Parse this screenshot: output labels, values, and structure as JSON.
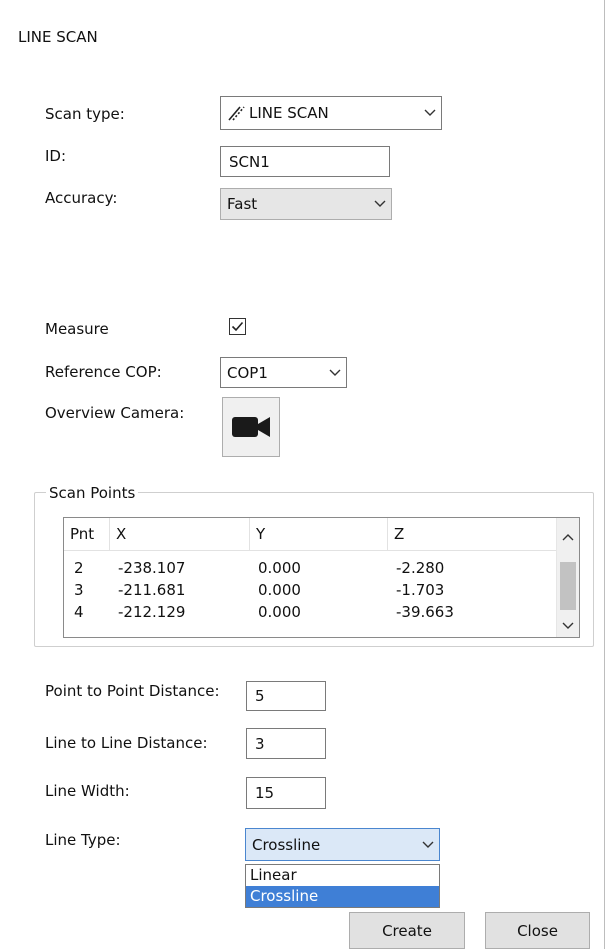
{
  "window": {
    "title": "LINE SCAN"
  },
  "scan_type": {
    "label": "Scan type:",
    "value": "LINE SCAN",
    "icon": "line-scan-icon"
  },
  "id": {
    "label": "ID:",
    "value": "SCN1"
  },
  "accuracy": {
    "label": "Accuracy:",
    "value": "Fast"
  },
  "measure": {
    "label": "Measure",
    "checked": true
  },
  "reference_cop": {
    "label": "Reference COP:",
    "value": "COP1"
  },
  "overview_camera": {
    "label": "Overview Camera:",
    "icon": "video-camera-icon"
  },
  "scan_points": {
    "title": "Scan Points",
    "columns": [
      "Pnt",
      "X",
      "Y",
      "Z"
    ],
    "rows": [
      [
        "2",
        "-238.107",
        "0.000",
        "-2.280"
      ],
      [
        "3",
        "-211.681",
        "0.000",
        "-1.703"
      ],
      [
        "4",
        "-212.129",
        "0.000",
        "-39.663"
      ]
    ]
  },
  "point_to_point": {
    "label": "Point to Point Distance:",
    "value": "5"
  },
  "line_to_line": {
    "label": "Line to Line Distance:",
    "value": "3"
  },
  "line_width": {
    "label": "Line Width:",
    "value": "15"
  },
  "line_type": {
    "label": "Line Type:",
    "value": "Crossline",
    "options": [
      "Linear",
      "Crossline"
    ],
    "highlighted": "Crossline"
  },
  "buttons": {
    "create": "Create",
    "close": "Close"
  },
  "colors": {
    "selection": "#3f7fd6",
    "combo_focus_bg": "#dbe8f7",
    "combo_focus_border": "#4a86cf"
  }
}
